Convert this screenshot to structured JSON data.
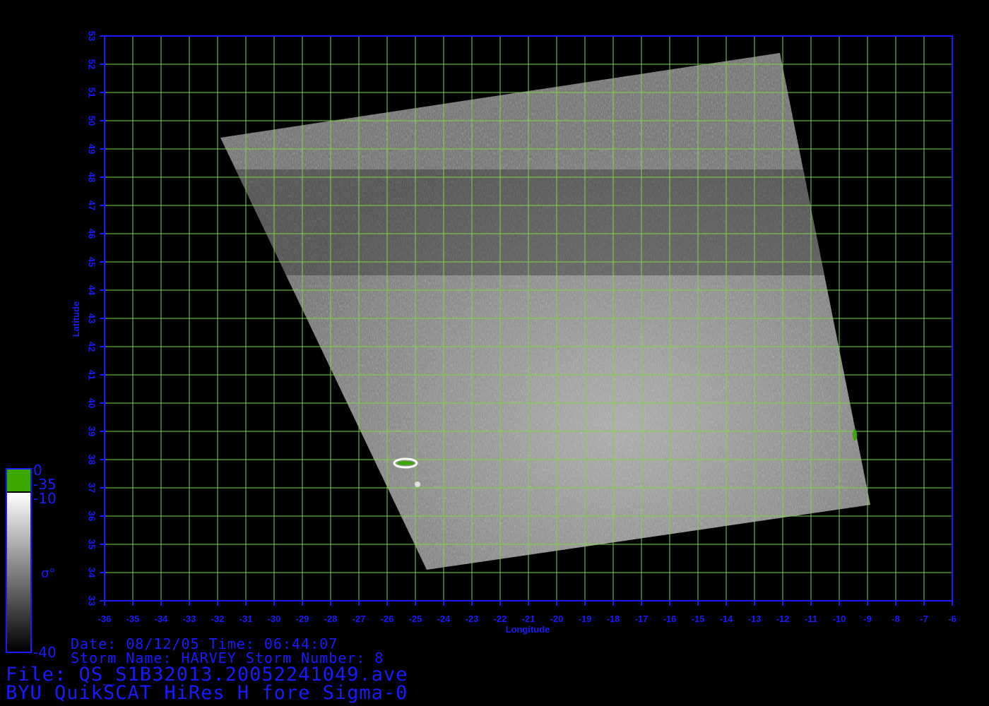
{
  "map": {
    "x_axis_label": "Longitude",
    "y_axis_label": "Latitude",
    "lon_range": [
      -36,
      -6
    ],
    "lat_range": [
      33,
      53
    ],
    "x_ticks": [
      -36,
      -35,
      -34,
      -33,
      -32,
      -31,
      -30,
      -29,
      -28,
      -27,
      -26,
      -25,
      -24,
      -23,
      -22,
      -21,
      -20,
      -19,
      -18,
      -17,
      -16,
      -15,
      -14,
      -13,
      -12,
      -11,
      -10,
      -9,
      -8,
      -7,
      -6
    ],
    "y_ticks": [
      33,
      34,
      35,
      36,
      37,
      38,
      39,
      40,
      41,
      42,
      43,
      44,
      45,
      46,
      47,
      48,
      49,
      50,
      51,
      52,
      53
    ],
    "grid_color": "#7fd63a",
    "axis_color": "#1a1aff",
    "swath_corners_lonlat": [
      [
        -31.9,
        49.4
      ],
      [
        -12.1,
        52.4
      ],
      [
        -8.9,
        36.4
      ],
      [
        -24.6,
        34.1
      ]
    ]
  },
  "colorbar": {
    "labels": {
      "top": "0",
      "green_low": "-35",
      "gray_top": "-10",
      "bottom": "-40",
      "symbol": "σ°"
    },
    "colors": {
      "land": "#3aa800",
      "high": "#ffffff",
      "low": "#000000"
    }
  },
  "info": {
    "date_line": "Date: 08/12/05   Time: 06:44:07",
    "storm_line": "Storm Name: HARVEY   Storm Number: 8",
    "file_line": "File: QS_S1B32013.20052241049.ave",
    "title_line": "BYU QuikSCAT HiRes H fore Sigma-0"
  }
}
